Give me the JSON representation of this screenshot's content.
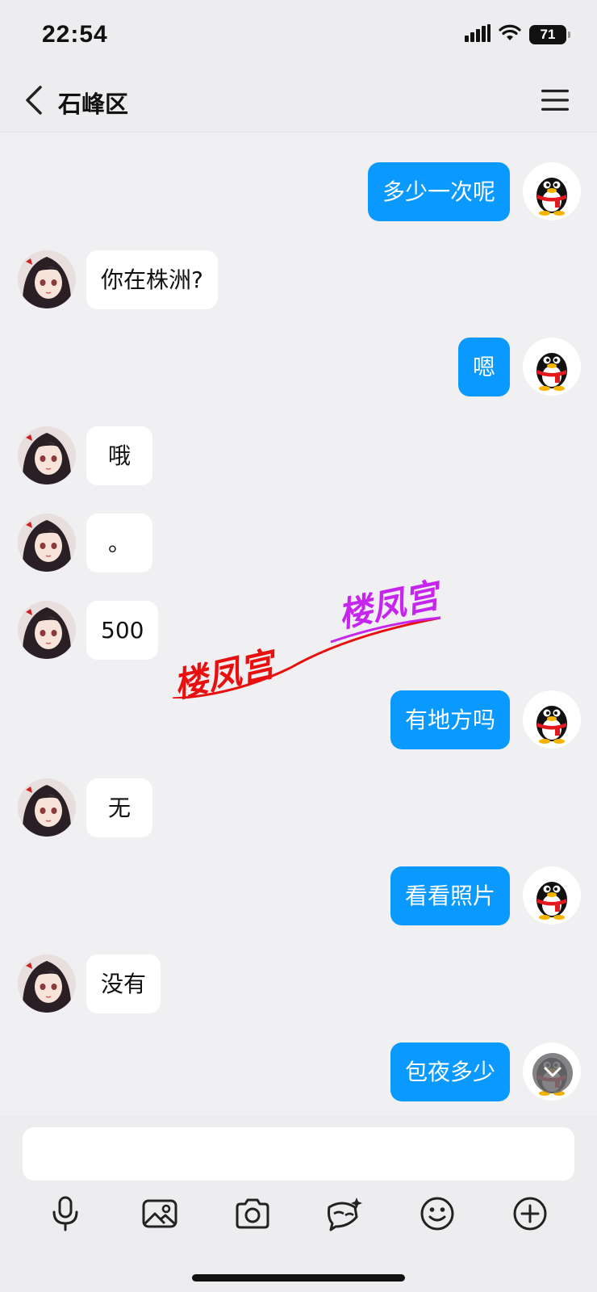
{
  "status": {
    "time": "22:54",
    "battery": "71"
  },
  "header": {
    "title": "石峰区"
  },
  "messages": [
    {
      "side": "right",
      "text": "多少一次呢"
    },
    {
      "side": "left",
      "text": "你在株洲?"
    },
    {
      "side": "right",
      "text": "嗯"
    },
    {
      "side": "left",
      "text": "哦"
    },
    {
      "side": "left",
      "text": "。"
    },
    {
      "side": "left",
      "text": "500"
    },
    {
      "side": "right",
      "text": "有地方吗"
    },
    {
      "side": "left",
      "text": "无"
    },
    {
      "side": "right",
      "text": "看看照片"
    },
    {
      "side": "left",
      "text": "没有"
    },
    {
      "side": "right",
      "text": "包夜多少"
    }
  ],
  "watermarks": [
    "楼凤宫",
    "楼凤宫"
  ],
  "composer": {
    "placeholder": ""
  },
  "toolbar": [
    "microphone-icon",
    "image-icon",
    "camera-icon",
    "magic-chat-icon",
    "emoji-icon",
    "plus-icon"
  ],
  "colors": {
    "sent_bubble": "#0a99ff",
    "received_bubble": "#ffffff",
    "watermark_red": "#e80f0f",
    "watermark_purple": "#c625ee"
  }
}
